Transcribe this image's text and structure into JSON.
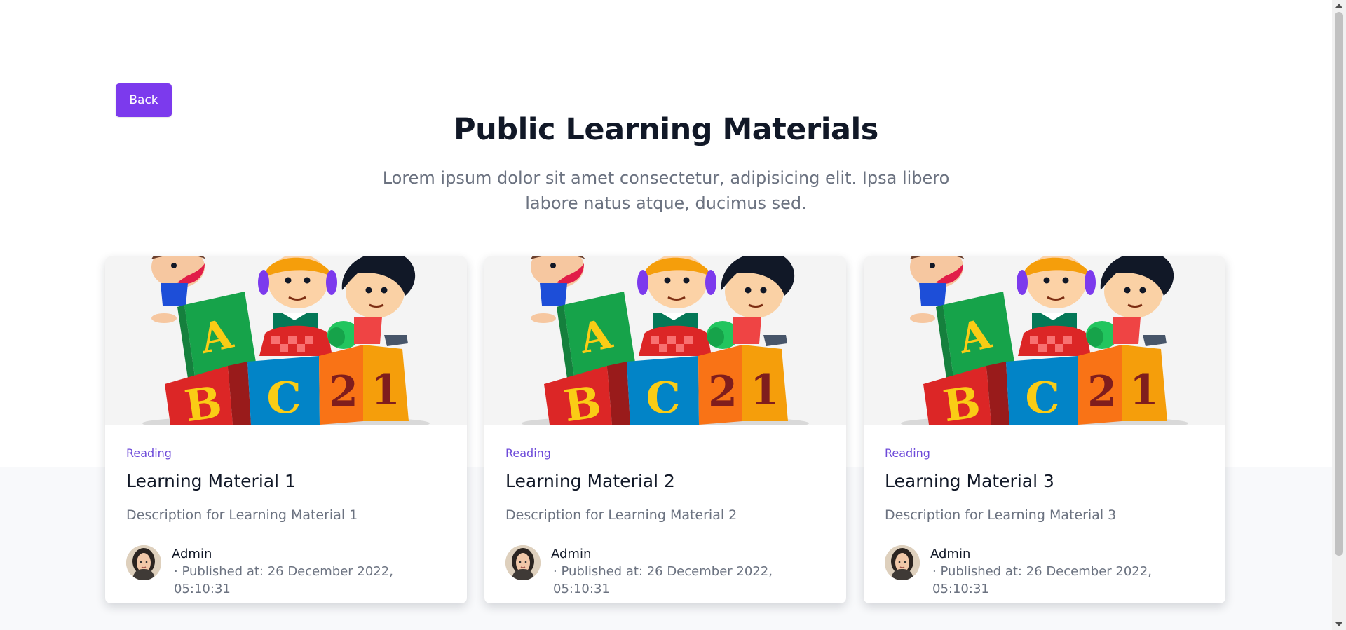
{
  "header": {
    "back_label": "Back",
    "title": "Public Learning Materials",
    "subtitle": "Lorem ipsum dolor sit amet consectetur, adipisicing elit. Ipsa libero labore natus atque, ducimus sed."
  },
  "cards": [
    {
      "category": "Reading",
      "title": "Learning Material 1",
      "description": "Description for Learning Material 1",
      "author": "Admin",
      "published": "· Published at: 26 December 2022, 05:10:31"
    },
    {
      "category": "Reading",
      "title": "Learning Material 2",
      "description": "Description for Learning Material 2",
      "author": "Admin",
      "published": "· Published at: 26 December 2022, 05:10:31"
    },
    {
      "category": "Reading",
      "title": "Learning Material 3",
      "description": "Description for Learning Material 3",
      "author": "Admin",
      "published": "· Published at: 26 December 2022, 05:10:31"
    }
  ],
  "image": {
    "block_letters": [
      "A",
      "B",
      "C",
      "2",
      "1"
    ]
  },
  "icons": {
    "avatar": "admin-avatar-icon",
    "scroll_up": "chevron-up-icon",
    "scroll_down": "chevron-down-icon"
  },
  "colors": {
    "accent": "#7c3aed",
    "category": "#6d4ad9",
    "heading": "#111827",
    "muted": "#6b7280",
    "band": "#f8f9fb"
  }
}
